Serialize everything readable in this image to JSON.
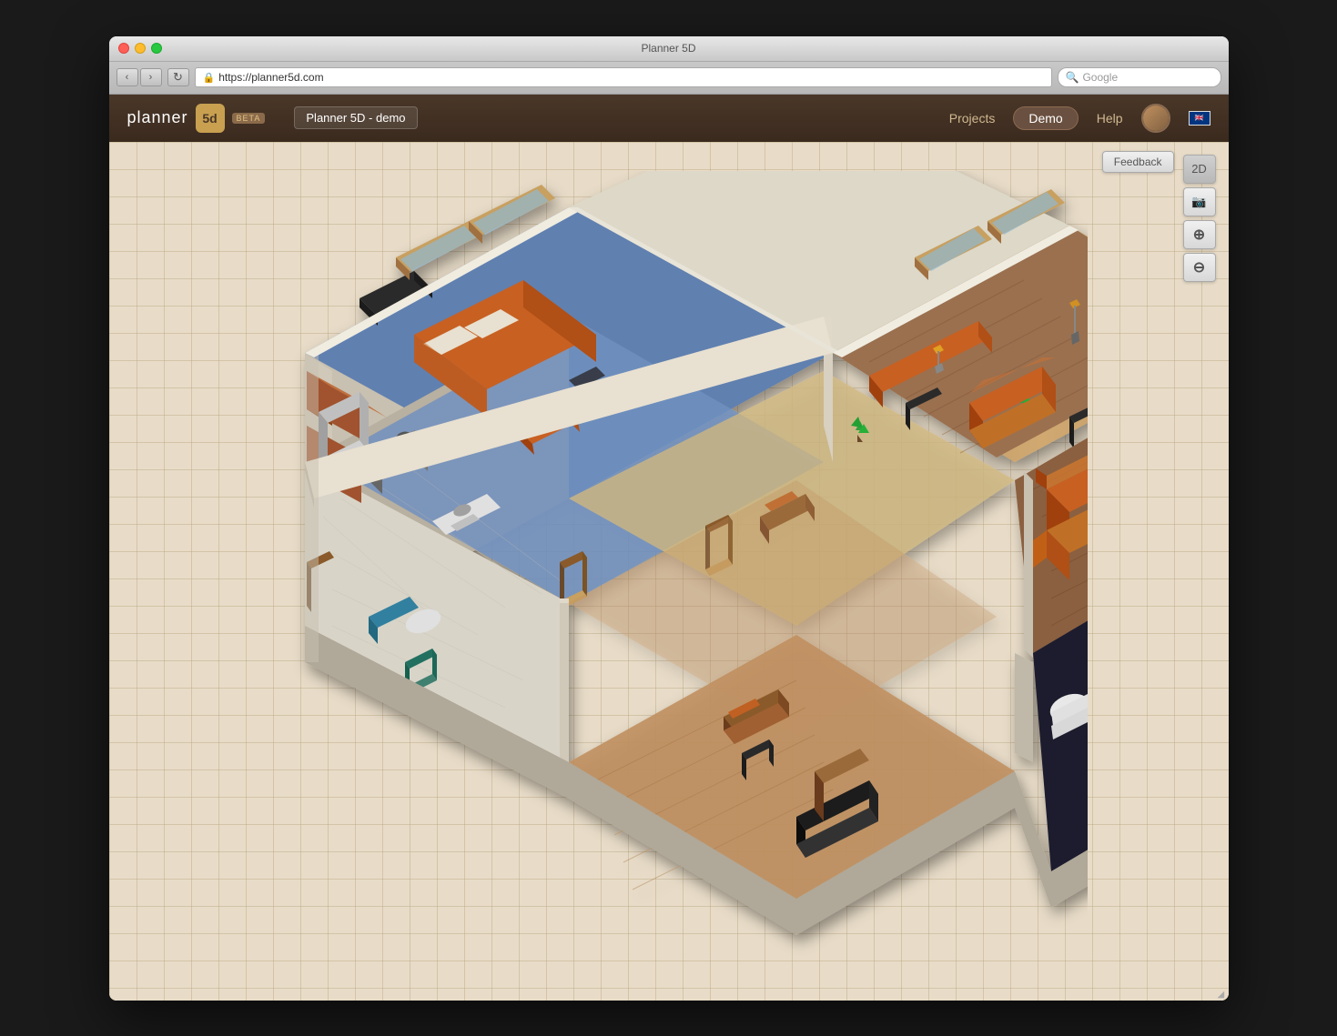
{
  "browser": {
    "title": "Planner 5D",
    "url": "https://planner5d.com",
    "search_placeholder": "Google",
    "back_label": "‹",
    "forward_label": "›",
    "reload_label": "↻"
  },
  "app": {
    "name": "planner",
    "logo_text": "5d",
    "beta_label": "beta",
    "project_name": "Planner 5D - demo",
    "nav": {
      "projects_label": "Projects",
      "demo_label": "Demo",
      "help_label": "Help"
    }
  },
  "toolbar": {
    "feedback_label": "Feedback",
    "view_2d_label": "2D",
    "screenshot_label": "📷",
    "zoom_in_label": "⊕",
    "zoom_out_label": "⊖"
  }
}
